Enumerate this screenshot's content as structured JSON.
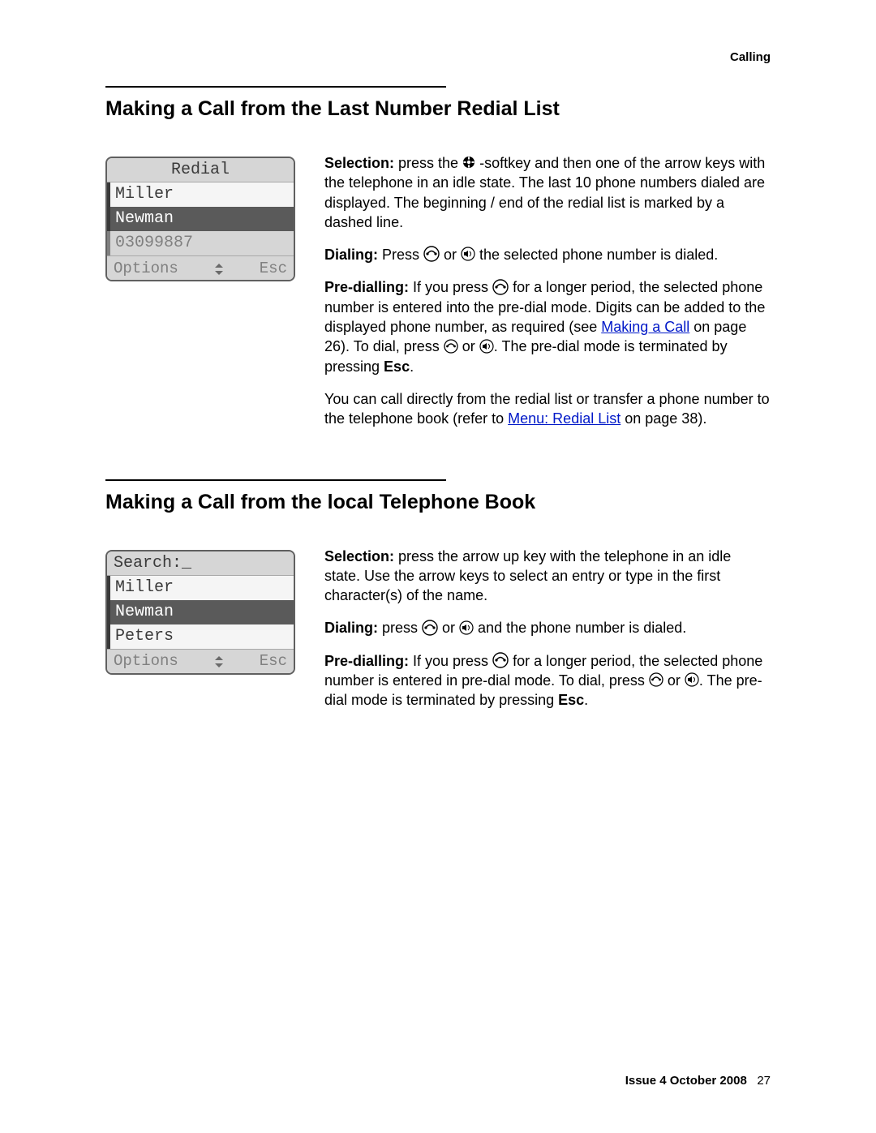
{
  "header": {
    "section_label": "Calling"
  },
  "section1": {
    "title": "Making a Call from the Last Number Redial List",
    "lcd": {
      "title": "Redial",
      "rows": [
        {
          "text": "Miller",
          "style": "normal"
        },
        {
          "text": "Newman",
          "style": "selected"
        },
        {
          "text": "03099887",
          "style": "dim"
        }
      ],
      "bottom_left": "Options",
      "bottom_right": "Esc"
    },
    "para1_a": "Selection:",
    "para1_b": " press the ",
    "para1_c": " -softkey and then one of the arrow keys with the telephone in an idle state. The last 10 phone numbers dialed are displayed. The beginning / end of the redial list is marked by a dashed line.",
    "para2_a": "Dialing:",
    "para2_b": " Press  ",
    "para2_c": " or ",
    "para2_d": " the selected phone number is dialed.",
    "para3_a": "Pre-dialling:",
    "para3_b": " If you press ",
    "para3_c": " for a longer period, the selected phone number is entered into the pre-dial mode. Digits can be added to the displayed phone number, as required (see ",
    "para3_link": "Making a Call",
    "para3_d": " on page 26). To dial, press ",
    "para3_e": " or ",
    "para3_f": ". The pre-dial mode is terminated by pressing ",
    "para3_g": "Esc",
    "para3_h": ".",
    "para4_a": "You can call directly from the redial list or transfer a phone number to the telephone book (refer to ",
    "para4_link": "Menu: Redial List",
    "para4_b": " on page 38)."
  },
  "section2": {
    "title": "Making a Call from the local Telephone Book",
    "lcd": {
      "title": "Search:_",
      "rows": [
        {
          "text": "Miller",
          "style": "normal"
        },
        {
          "text": "Newman",
          "style": "selected"
        },
        {
          "text": "Peters",
          "style": "normal"
        }
      ],
      "bottom_left": "Options",
      "bottom_right": "Esc"
    },
    "para1_a": "Selection:",
    "para1_b": " press the arrow up key with the telephone in an idle state. Use the arrow keys to select an entry or type in the first character(s) of the name.",
    "para2_a": "Dialing:",
    "para2_b": " press ",
    "para2_c": " or ",
    "para2_d": " and the phone number is dialed.",
    "para3_a": "Pre-dialling:",
    "para3_b": " If you press ",
    "para3_c": " for a longer period, the selected phone number is entered in pre-dial mode. To dial, press ",
    "para3_d": " or ",
    "para3_e": ". The pre-dial mode is terminated by pressing ",
    "para3_f": "Esc",
    "para3_g": "."
  },
  "footer": {
    "issue": "Issue 4   October 2008",
    "page": "27"
  }
}
